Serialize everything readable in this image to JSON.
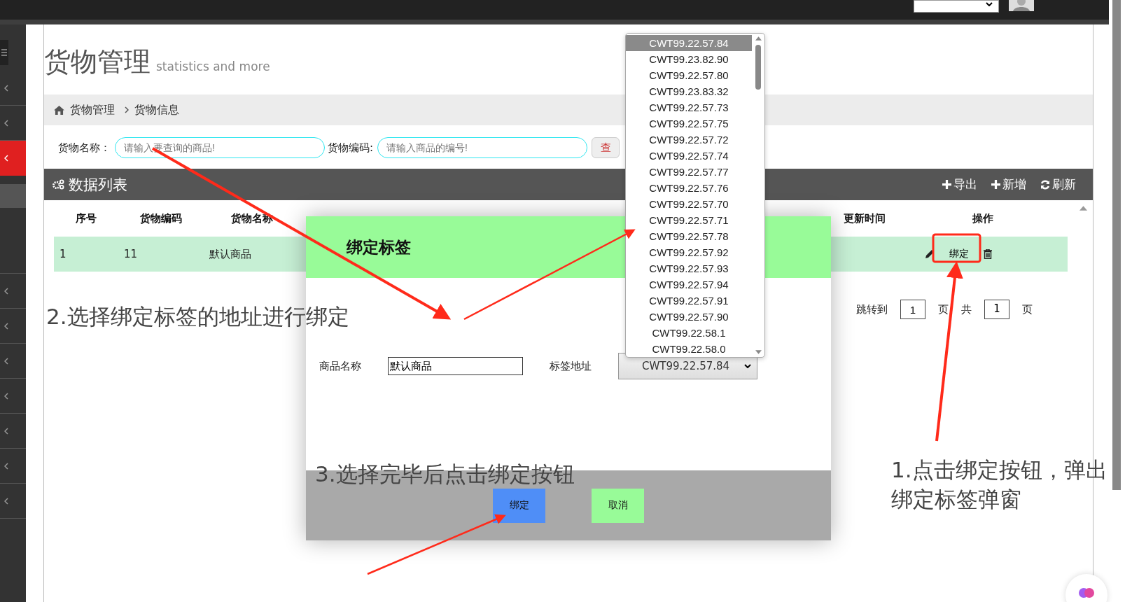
{
  "sidebar": {
    "items": [
      {
        "kind": "toggle"
      },
      {
        "kind": "menu",
        "selected": false
      },
      {
        "kind": "menu",
        "selected": false
      },
      {
        "kind": "menu",
        "selected": true
      },
      {
        "kind": "sub",
        "selected": false
      },
      {
        "kind": "menu",
        "selected": false
      },
      {
        "kind": "menu",
        "selected": false
      },
      {
        "kind": "menu",
        "selected": false
      },
      {
        "kind": "menu",
        "selected": false
      },
      {
        "kind": "menu",
        "selected": false
      },
      {
        "kind": "menu",
        "selected": false
      },
      {
        "kind": "menu",
        "selected": false
      }
    ]
  },
  "page": {
    "title": "货物管理",
    "subtitle": "statistics and more"
  },
  "breadcrumb": [
    "货物管理",
    "货物信息"
  ],
  "search": {
    "fields": [
      {
        "label": "货物名称：",
        "placeholder": "请输入要查询的商品!"
      },
      {
        "label": "货物编码:",
        "placeholder": "请输入商品的编号!"
      }
    ],
    "button": "查"
  },
  "panel": {
    "title": "数据列表",
    "actions": [
      {
        "label": "导出",
        "kind": "add"
      },
      {
        "label": "新增",
        "kind": "add"
      },
      {
        "label": "刷新",
        "kind": "refresh"
      }
    ]
  },
  "table": {
    "columns": [
      "序号",
      "货物编码",
      "货物名称",
      "更新时间",
      "操作"
    ],
    "rows": [
      {
        "cells": [
          "1",
          "11",
          "默认商品"
        ],
        "selected": true,
        "action": "绑定"
      }
    ]
  },
  "pagination": {
    "jump_label": "跳转到",
    "page": "1",
    "page_unit": "页",
    "total_label": "共",
    "total": "1",
    "total_unit": "页"
  },
  "modal": {
    "title": "绑定标签",
    "fields": [
      {
        "label": "商品名称",
        "value": "默认商品",
        "kind": "text"
      },
      {
        "label": "标签地址",
        "value": "CWT99.22.57.84",
        "kind": "select"
      }
    ],
    "buttons": [
      {
        "label": "绑定",
        "kind": "primary"
      },
      {
        "label": "取消",
        "kind": "secondary"
      }
    ]
  },
  "dropdown": {
    "options": [
      {
        "label": "CWT99.22.57.84",
        "selected": true
      },
      {
        "label": "CWT99.23.82.90",
        "selected": false
      },
      {
        "label": "CWT99.22.57.80",
        "selected": false
      },
      {
        "label": "CWT99.23.83.32",
        "selected": false
      },
      {
        "label": "CWT99.22.57.73",
        "selected": false
      },
      {
        "label": "CWT99.22.57.75",
        "selected": false
      },
      {
        "label": "CWT99.22.57.72",
        "selected": false
      },
      {
        "label": "CWT99.22.57.74",
        "selected": false
      },
      {
        "label": "CWT99.22.57.77",
        "selected": false
      },
      {
        "label": "CWT99.22.57.76",
        "selected": false
      },
      {
        "label": "CWT99.22.57.70",
        "selected": false
      },
      {
        "label": "CWT99.22.57.71",
        "selected": false
      },
      {
        "label": "CWT99.22.57.78",
        "selected": false
      },
      {
        "label": "CWT99.22.57.92",
        "selected": false
      },
      {
        "label": "CWT99.22.57.93",
        "selected": false
      },
      {
        "label": "CWT99.22.57.94",
        "selected": false
      },
      {
        "label": "CWT99.22.57.91",
        "selected": false
      },
      {
        "label": "CWT99.22.57.90",
        "selected": false
      },
      {
        "label": "CWT99.22.58.1",
        "selected": false
      },
      {
        "label": "CWT99.22.58.0",
        "selected": false
      }
    ]
  },
  "annotations": [
    "2.选择绑定标签的地址进行绑定",
    "3.选择完毕后点击绑定按钮",
    "1.点击绑定按钮，弹出绑定标签弹窗"
  ]
}
